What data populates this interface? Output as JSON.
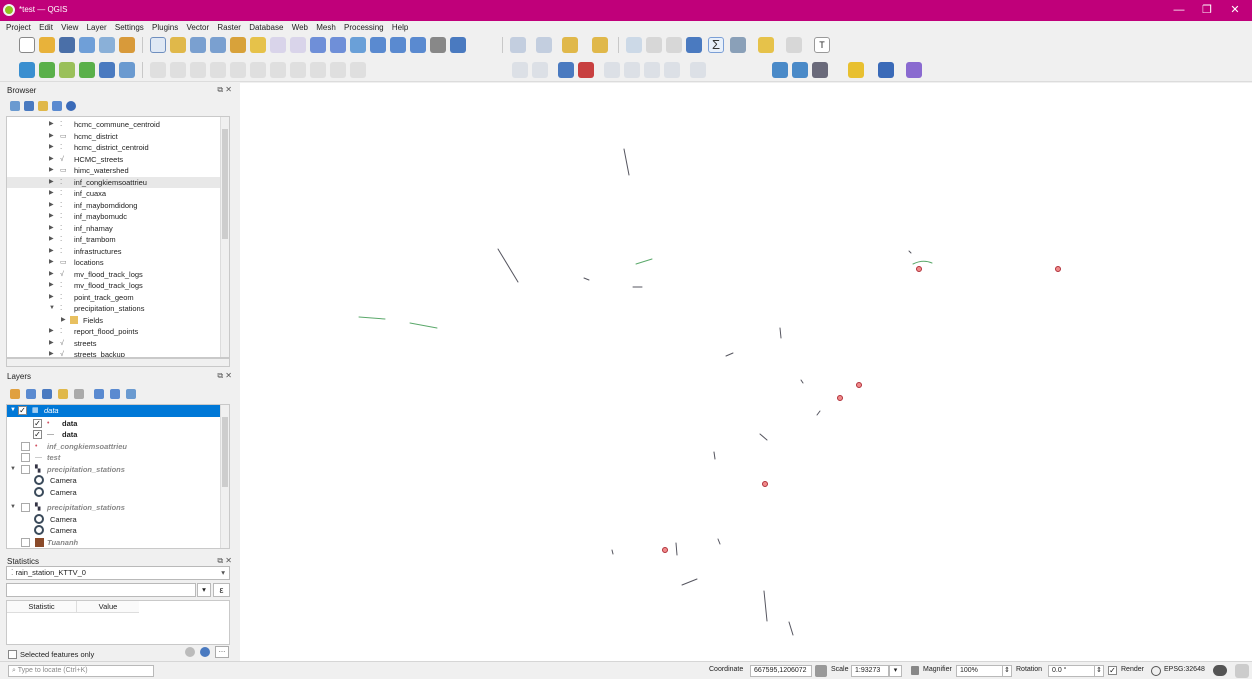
{
  "window": {
    "title": "*test — QGIS"
  },
  "menu": [
    "Project",
    "Edit",
    "View",
    "Layer",
    "Settings",
    "Plugins",
    "Vector",
    "Raster",
    "Database",
    "Web",
    "Mesh",
    "Processing",
    "Help"
  ],
  "browser": {
    "title": "Browser",
    "items": [
      {
        "label": "hcmc_commune_centroid",
        "icon": "point-layer-icon"
      },
      {
        "label": "hcmc_district",
        "icon": "polygon-layer-icon"
      },
      {
        "label": "hcmc_district_centroid",
        "icon": "point-layer-icon"
      },
      {
        "label": "HCMC_streets",
        "icon": "line-layer-icon"
      },
      {
        "label": "himc_watershed",
        "icon": "polygon-layer-icon"
      },
      {
        "label": "inf_congkiemsoattrieu",
        "icon": "point-layer-icon"
      },
      {
        "label": "inf_cuaxa",
        "icon": "point-layer-icon"
      },
      {
        "label": "inf_maybomdidong",
        "icon": "point-layer-icon"
      },
      {
        "label": "inf_maybomudc",
        "icon": "point-layer-icon"
      },
      {
        "label": "inf_nhamay",
        "icon": "point-layer-icon"
      },
      {
        "label": "inf_trambom",
        "icon": "point-layer-icon"
      },
      {
        "label": "infrastructures",
        "icon": "point-layer-icon"
      },
      {
        "label": "locations",
        "icon": "polygon-layer-icon"
      },
      {
        "label": "mv_flood_track_logs",
        "icon": "line-layer-icon"
      },
      {
        "label": "mv_flood_track_logs",
        "icon": "point-layer-icon"
      },
      {
        "label": "point_track_geom",
        "icon": "point-layer-icon"
      },
      {
        "label": "precipitation_stations",
        "icon": "point-layer-icon"
      },
      {
        "label": "Fields",
        "icon": "fields-icon"
      },
      {
        "label": "report_flood_points",
        "icon": "point-layer-icon"
      },
      {
        "label": "streets",
        "icon": "line-layer-icon"
      },
      {
        "label": "streets_backup",
        "icon": "line-layer-icon"
      }
    ]
  },
  "layers": {
    "title": "Layers",
    "items": [
      {
        "label": "data",
        "checked": "✓",
        "selected": true
      },
      {
        "label": "data",
        "checked": "✓"
      },
      {
        "label": "data",
        "checked": "✓"
      },
      {
        "label": "inf_congkiemsoattrieu",
        "checked": ""
      },
      {
        "label": "test",
        "checked": ""
      },
      {
        "label": "precipitation_stations",
        "checked": ""
      },
      {
        "label": "Camera"
      },
      {
        "label": "Camera"
      },
      {
        "label": "precipitation_stations",
        "checked": ""
      },
      {
        "label": "Camera"
      },
      {
        "label": "Camera"
      },
      {
        "label": "Tuananh",
        "checked": ""
      }
    ]
  },
  "statistics": {
    "title": "Statistics",
    "layer": "rain_station_KTTV_0",
    "expression_button": "ε",
    "col_statistic": "Statistic",
    "col_value": "Value",
    "selected_only": "Selected features only"
  },
  "locator": {
    "placeholder": "Type to locate (Ctrl+K)"
  },
  "status": {
    "coordinate_label": "Coordinate",
    "coordinate": "667595,1206072",
    "scale_label": "Scale",
    "scale": "1:93273",
    "magnifier_label": "Magnifier",
    "magnifier": "100%",
    "rotation_label": "Rotation",
    "rotation": "0.0 °",
    "render_label": "Render",
    "crs": "EPSG:32648"
  },
  "colors": {
    "titlebar": "#c0007a",
    "selection": "#0078d7",
    "point_fill": "#f08a8a",
    "point_stroke": "#b0303a",
    "line_dark": "#55555f",
    "line_green": "#5aa86a"
  }
}
